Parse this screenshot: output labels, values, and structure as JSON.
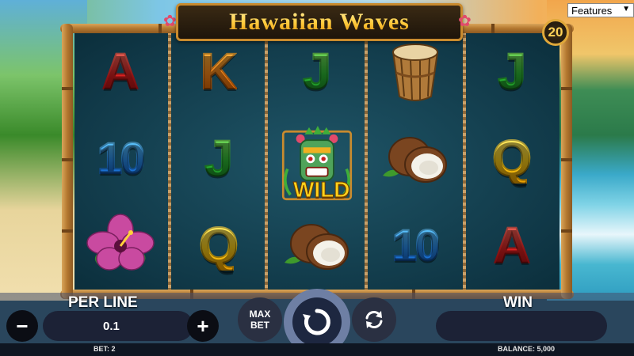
{
  "title": "Hawaiian Waves",
  "features_dropdown": {
    "selected": "Features"
  },
  "lines_count": "20",
  "reels": [
    [
      {
        "type": "letter",
        "text": "A",
        "color": "red"
      },
      {
        "type": "letter",
        "text": "10",
        "color": "blue"
      },
      {
        "type": "image",
        "name": "hibiscus-flower"
      }
    ],
    [
      {
        "type": "letter",
        "text": "K",
        "color": "orange"
      },
      {
        "type": "letter",
        "text": "J",
        "color": "green"
      },
      {
        "type": "letter",
        "text": "Q",
        "color": "yellow"
      }
    ],
    [
      {
        "type": "letter",
        "text": "J",
        "color": "green"
      },
      {
        "type": "image",
        "name": "tiki-mask-wild"
      },
      {
        "type": "image",
        "name": "coconut"
      }
    ],
    [
      {
        "type": "image",
        "name": "drum"
      },
      {
        "type": "image",
        "name": "coconut"
      },
      {
        "type": "letter",
        "text": "10",
        "color": "blue"
      }
    ],
    [
      {
        "type": "letter",
        "text": "J",
        "color": "green"
      },
      {
        "type": "letter",
        "text": "Q",
        "color": "yellow"
      },
      {
        "type": "letter",
        "text": "A",
        "color": "red"
      }
    ]
  ],
  "wild_label": "WILD",
  "controls": {
    "per_line_label": "PER LINE",
    "per_line_value": "0.1",
    "minus_label": "−",
    "plus_label": "+",
    "max_bet_line1": "MAX",
    "max_bet_line2": "BET",
    "win_label": "WIN",
    "win_value": ""
  },
  "footer": {
    "bet": "BET: 2",
    "balance": "BALANCE: 5,000"
  }
}
